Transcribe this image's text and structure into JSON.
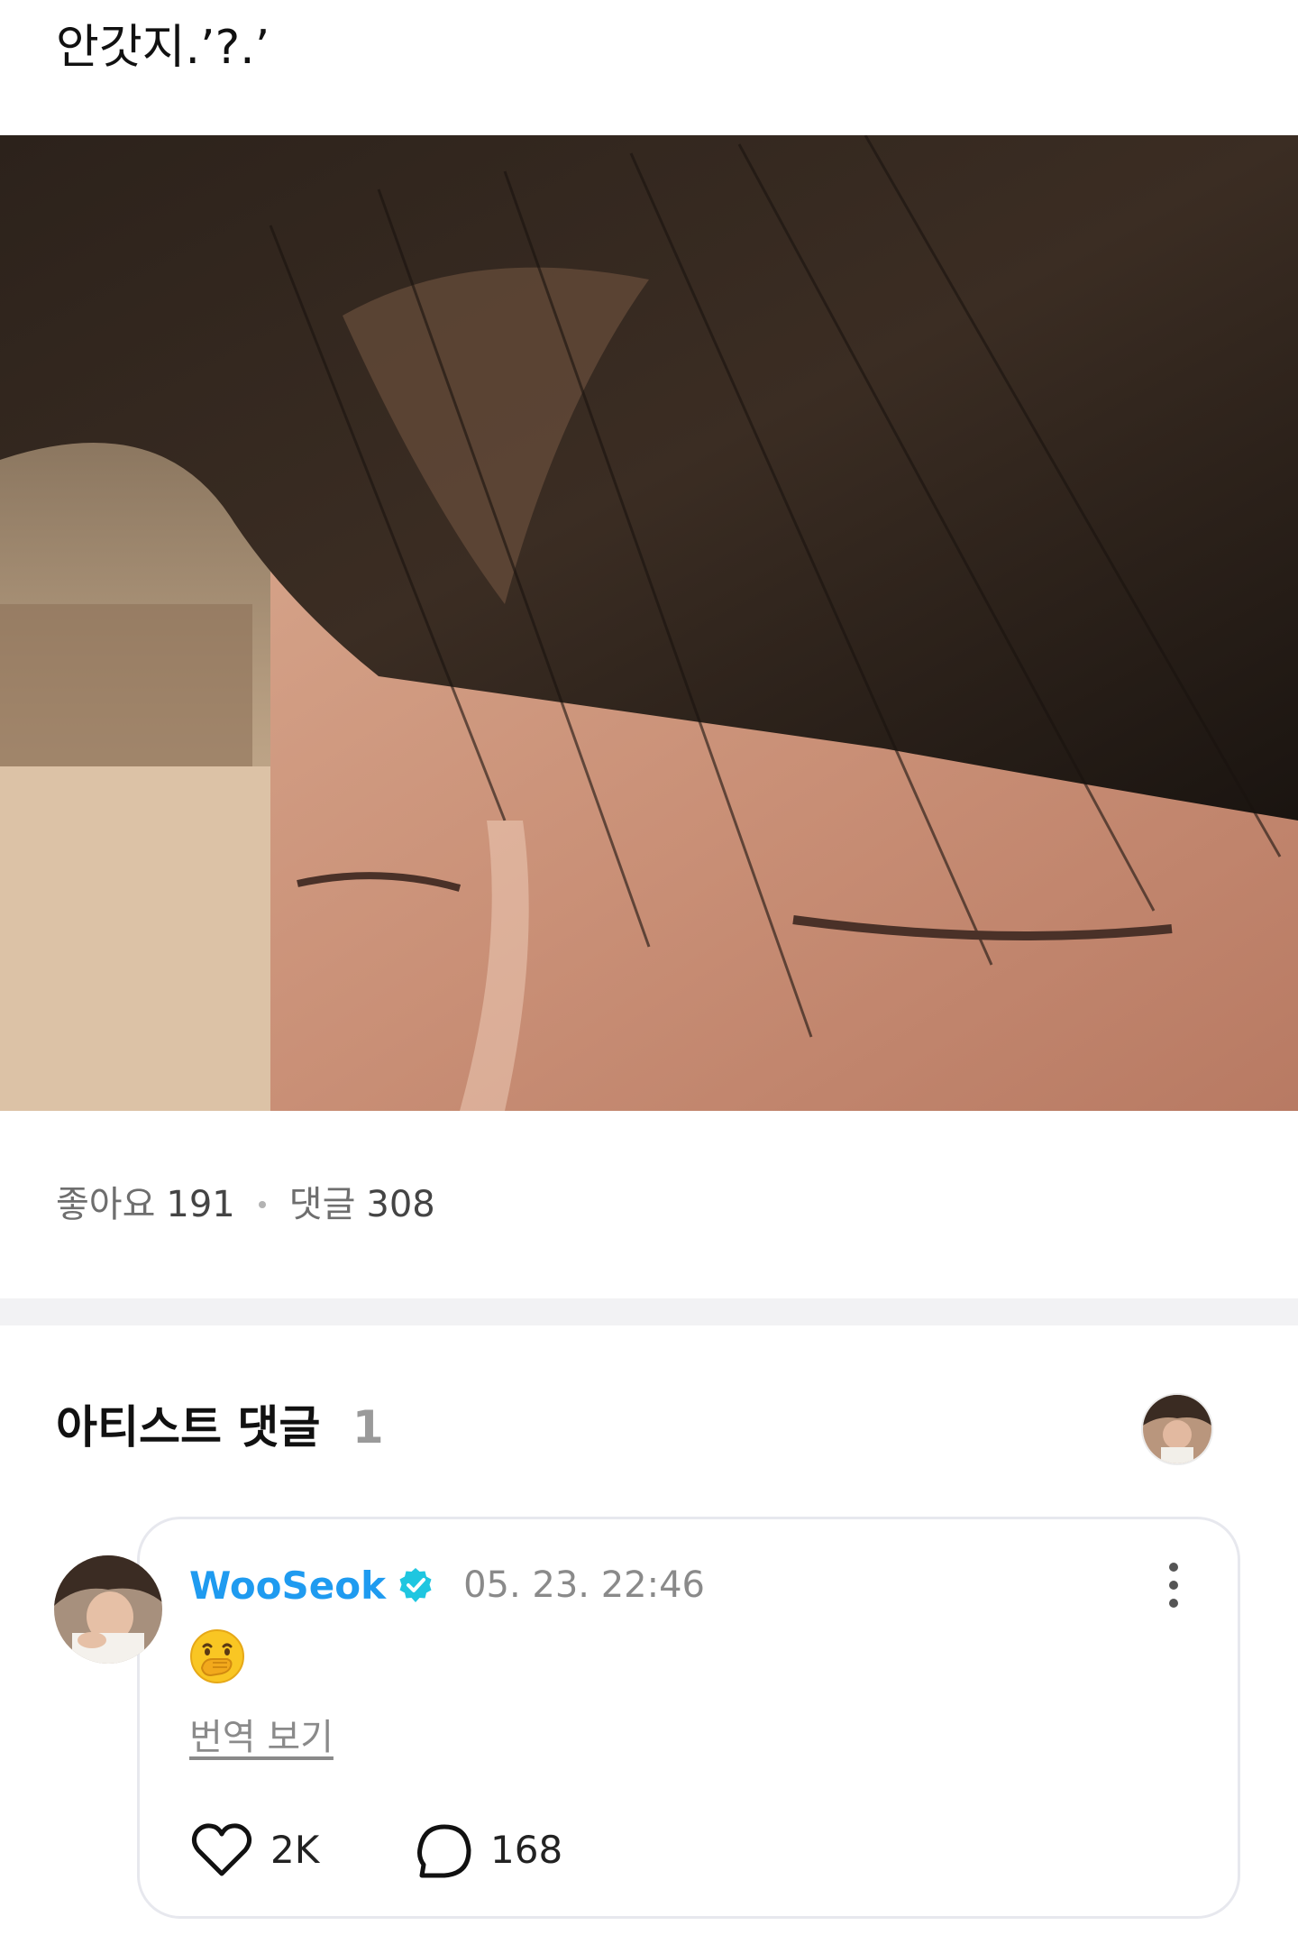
{
  "post": {
    "text": "안갓지.’?.’"
  },
  "stats": {
    "likes_label": "좋아요",
    "likes_count": "191",
    "comments_label": "댓글",
    "comments_count": "308"
  },
  "artist_comments": {
    "title": "아티스트 댓글",
    "count": "1"
  },
  "comment": {
    "author": "WooSeok",
    "timestamp": "05. 23. 22:46",
    "translate_label": "번역 보기",
    "like_count": "2K",
    "reply_count": "168",
    "emoji": "face-with-hand-over-mouth",
    "author_color": "#1f9bf0",
    "verified_color": "#1fc6e0"
  }
}
